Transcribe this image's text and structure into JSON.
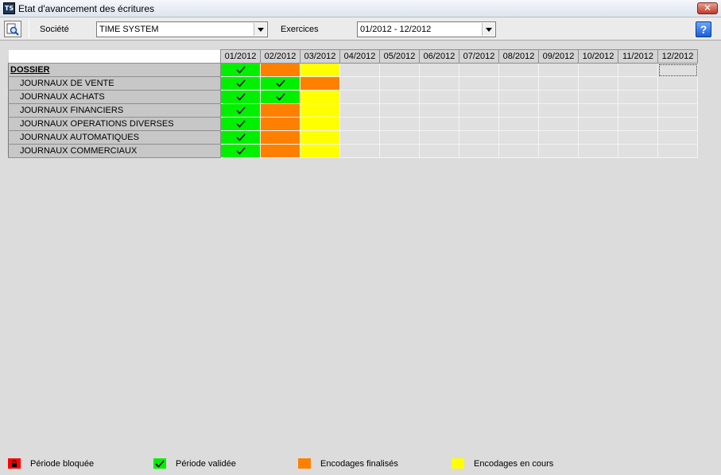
{
  "window": {
    "title": "Etat d'avancement des écritures",
    "app_icon_text": "TS",
    "close_label": "✕"
  },
  "toolbar": {
    "societe_label": "Société",
    "societe_value": "TIME SYSTEM",
    "exercices_label": "Exercices",
    "exercices_value": "01/2012 - 12/2012",
    "help_label": "?"
  },
  "grid": {
    "months": [
      "01/2012",
      "02/2012",
      "03/2012",
      "04/2012",
      "05/2012",
      "06/2012",
      "07/2012",
      "08/2012",
      "09/2012",
      "10/2012",
      "11/2012",
      "12/2012"
    ],
    "rows": [
      {
        "label": "DOSSIER",
        "cells": [
          "valid",
          "final",
          "progress",
          "",
          "",
          "",
          "",
          "",
          "",
          "",
          "",
          ""
        ]
      },
      {
        "label": "JOURNAUX DE VENTE",
        "cells": [
          "valid",
          "valid",
          "final",
          "",
          "",
          "",
          "",
          "",
          "",
          "",
          "",
          ""
        ]
      },
      {
        "label": "JOURNAUX ACHATS",
        "cells": [
          "valid",
          "valid",
          "progress",
          "",
          "",
          "",
          "",
          "",
          "",
          "",
          "",
          ""
        ]
      },
      {
        "label": "JOURNAUX FINANCIERS",
        "cells": [
          "valid",
          "final",
          "progress",
          "",
          "",
          "",
          "",
          "",
          "",
          "",
          "",
          ""
        ]
      },
      {
        "label": "JOURNAUX OPERATIONS DIVERSES",
        "cells": [
          "valid",
          "final",
          "progress",
          "",
          "",
          "",
          "",
          "",
          "",
          "",
          "",
          ""
        ]
      },
      {
        "label": "JOURNAUX AUTOMATIQUES",
        "cells": [
          "valid",
          "final",
          "progress",
          "",
          "",
          "",
          "",
          "",
          "",
          "",
          "",
          ""
        ]
      },
      {
        "label": "JOURNAUX COMMERCIAUX",
        "cells": [
          "valid",
          "final",
          "progress",
          "",
          "",
          "",
          "",
          "",
          "",
          "",
          "",
          ""
        ]
      }
    ]
  },
  "legend": [
    {
      "key": "locked",
      "label": "Période bloquée",
      "color": "#ff0000"
    },
    {
      "key": "valid",
      "label": "Période validée",
      "color": "#00f000"
    },
    {
      "key": "final",
      "label": "Encodages finalisés",
      "color": "#ff8000"
    },
    {
      "key": "progress",
      "label": "Encodages en cours",
      "color": "#ffff00"
    }
  ],
  "colors": {
    "valid": "#00f000",
    "final": "#ff8000",
    "progress": "#ffff00",
    "empty": "#e0e0e0",
    "locked": "#ff0000"
  }
}
